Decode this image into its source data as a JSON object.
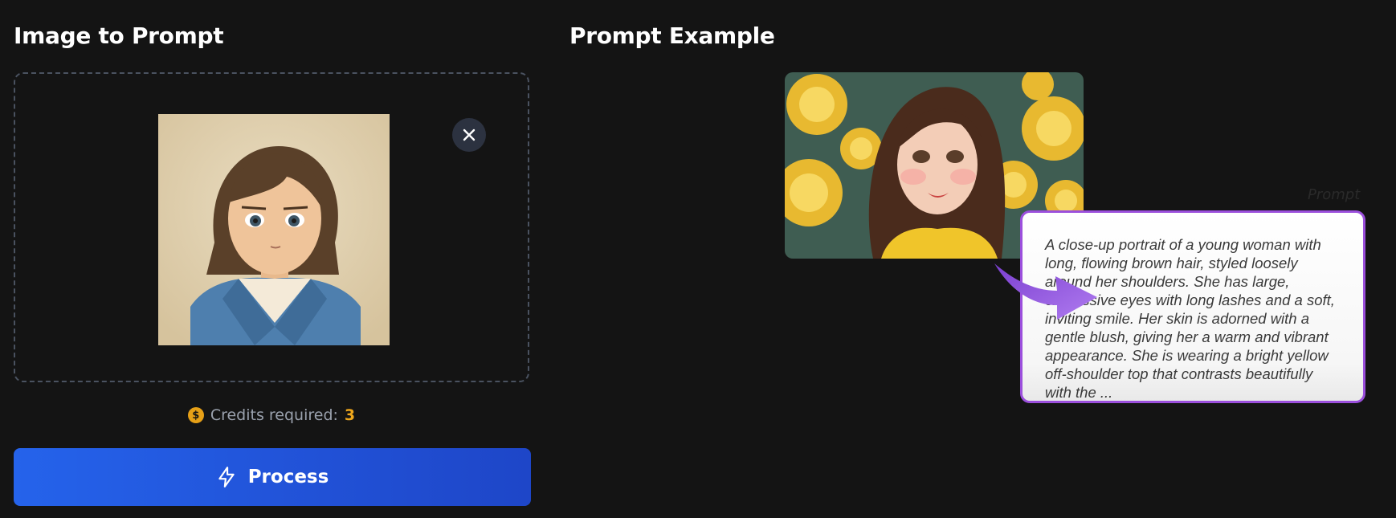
{
  "left_panel": {
    "title": "Image to Prompt",
    "remove_icon": "close-icon",
    "credits_label": "Credits required:",
    "credits_value": "3",
    "process_label": "Process",
    "process_icon": "lightning-icon"
  },
  "right_panel": {
    "title": "Prompt Example",
    "watermark": "Prompt",
    "prompt_text": "A close-up portrait of a young woman with long, flowing brown hair, styled loosely around her shoulders. She has large, expressive eyes with long lashes and a soft, inviting smile. Her skin is adorned with a gentle blush, giving her a warm and vibrant appearance. She is wearing a bright yellow off-shoulder top that contrasts beautifully with the ..."
  },
  "colors": {
    "background": "#141414",
    "accent_blue": "#2563eb",
    "credit_gold": "#f0a81c",
    "card_border": "#9b4fdc"
  }
}
